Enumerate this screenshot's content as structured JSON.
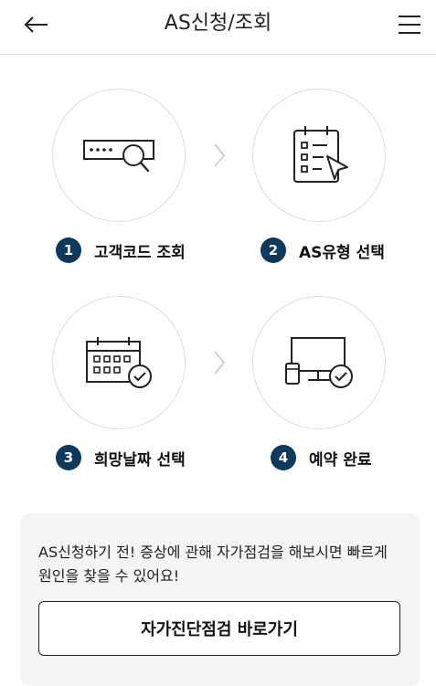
{
  "header": {
    "title": "AS신청/조회",
    "back_icon": "back-arrow-icon",
    "menu_icon": "hamburger-menu-icon"
  },
  "steps": [
    {
      "number": "1",
      "label": "고객코드 조회",
      "icon": "code-search-icon"
    },
    {
      "number": "2",
      "label": "AS유형 선택",
      "icon": "checklist-pointer-icon"
    },
    {
      "number": "3",
      "label": "희망날짜 선택",
      "icon": "calendar-check-icon"
    },
    {
      "number": "4",
      "label": "예약 완료",
      "icon": "devices-check-icon"
    }
  ],
  "info": {
    "text": "AS신청하기 전! 증상에 관해 자가점검을 해보시면 빠르게 원인을 찾을 수 있어요!",
    "button_label": "자가진단점검 바로가기"
  },
  "colors": {
    "step_badge": "#0c3a5e",
    "info_bg": "#f4f4f4"
  }
}
